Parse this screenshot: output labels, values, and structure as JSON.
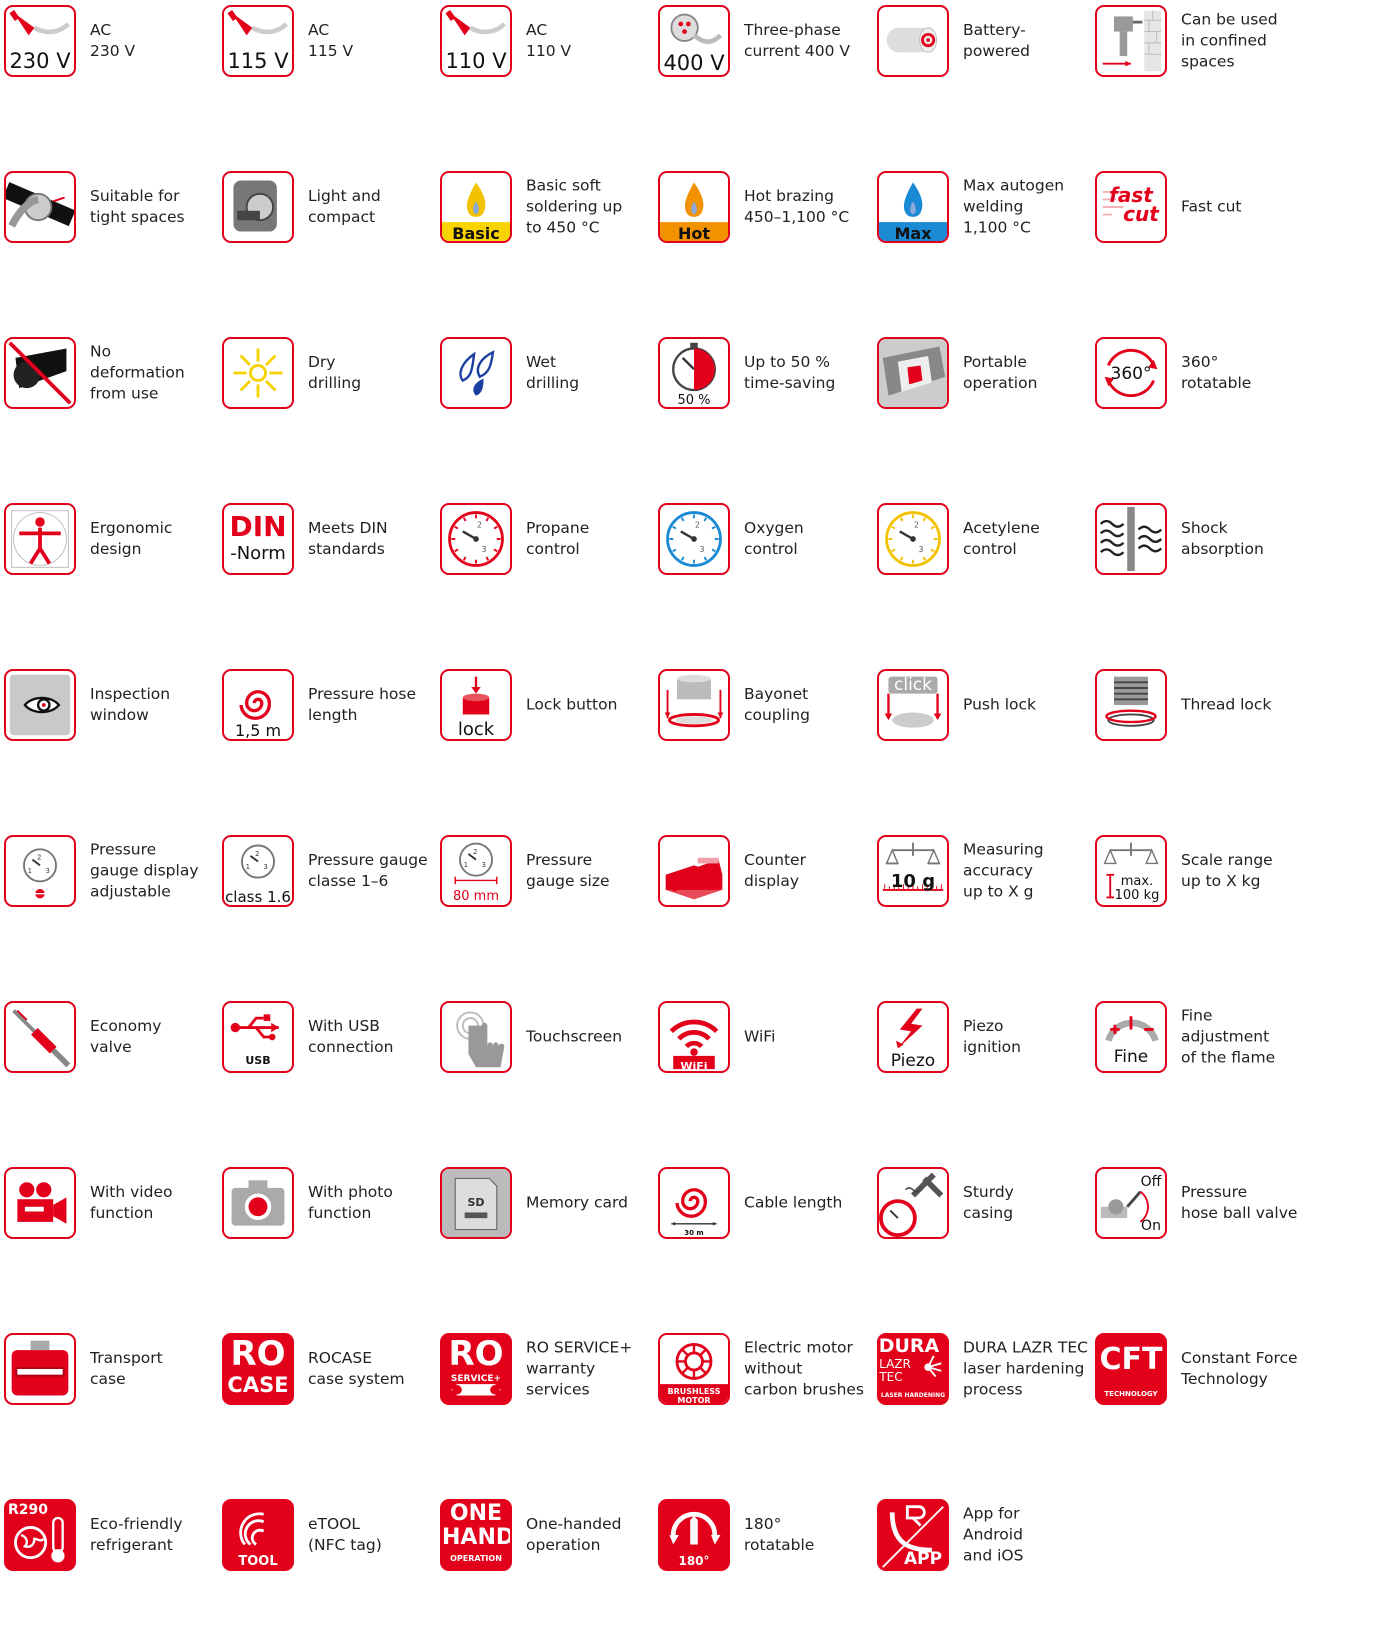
{
  "colors": {
    "brand_red": "#e2001a",
    "text": "#222222",
    "grey": "#9a9a9a",
    "blue": "#1a3fa0",
    "cyan": "#1a8ad4",
    "yellow": "#f2c200",
    "orange": "#f39200"
  },
  "rows": [
    [
      {
        "label": "AC\n230 V",
        "badge": "230 V",
        "icon": "plug-icon"
      },
      {
        "label": "AC\n115 V",
        "badge": "115 V",
        "icon": "plug-icon"
      },
      {
        "label": "AC\n110 V",
        "badge": "110 V",
        "icon": "plug-icon"
      },
      {
        "label": "Three-phase\ncurrent 400 V",
        "badge": "400 V",
        "icon": "three-phase-plug-icon"
      },
      {
        "label": "Battery-\npowered",
        "icon": "battery-icon"
      },
      {
        "label": "Can be used\nin confined\nspaces",
        "icon": "confined-space-icon"
      }
    ],
    [
      {
        "label": "Suitable for\ntight spaces",
        "icon": "tight-space-icon"
      },
      {
        "label": "Light and\ncompact",
        "icon": "compact-tool-icon"
      },
      {
        "label": "Basic soft\nsoldering up\nto 450 °C",
        "badge": "Basic",
        "icon": "flame-basic-icon"
      },
      {
        "label": "Hot brazing\n450–1,100 °C",
        "badge": "Hot",
        "icon": "flame-hot-icon"
      },
      {
        "label": "Max autogen\nwelding\n1,100 °C",
        "badge": "Max",
        "icon": "flame-max-icon"
      },
      {
        "label": "Fast cut",
        "badge": "fast",
        "badge2": "cut",
        "icon": "fast-cut-icon"
      }
    ],
    [
      {
        "label": "No\ndeformation\nfrom use",
        "icon": "no-deformation-icon"
      },
      {
        "label": "Dry\ndrilling",
        "icon": "sun-icon"
      },
      {
        "label": "Wet\ndrilling",
        "icon": "water-drops-icon"
      },
      {
        "label": "Up to 50 %\ntime-saving",
        "badge": "50 %",
        "icon": "stopwatch-icon"
      },
      {
        "label": "Portable\noperation",
        "icon": "portable-icon"
      },
      {
        "label": "360°\nrotatable",
        "badge": "360°",
        "icon": "rotate-360-icon"
      }
    ],
    [
      {
        "label": "Ergonomic\ndesign",
        "icon": "ergonomic-icon"
      },
      {
        "label": "Meets DIN\nstandards",
        "badge": "DIN",
        "badge2": "-Norm",
        "icon": "din-icon"
      },
      {
        "label": "Propane\ncontrol",
        "icon": "gauge-red-icon"
      },
      {
        "label": "Oxygen\ncontrol",
        "icon": "gauge-blue-icon"
      },
      {
        "label": "Acetylene\ncontrol",
        "icon": "gauge-yellow-icon"
      },
      {
        "label": "Shock\nabsorption",
        "icon": "shock-absorption-icon"
      }
    ],
    [
      {
        "label": "Inspection\nwindow",
        "icon": "eye-icon"
      },
      {
        "label": "Pressure hose\nlength",
        "badge": "1,5 m",
        "icon": "hose-spiral-icon"
      },
      {
        "label": "Lock button",
        "badge": "lock",
        "icon": "lock-button-icon"
      },
      {
        "label": "Bayonet\ncoupling",
        "icon": "bayonet-icon"
      },
      {
        "label": "Push lock",
        "badge": "click",
        "icon": "push-lock-icon"
      },
      {
        "label": "Thread lock",
        "icon": "thread-lock-icon"
      }
    ],
    [
      {
        "label": "Pressure\ngauge display\nadjustable",
        "icon": "gauge-adjust-icon"
      },
      {
        "label": "Pressure gauge\nclasse 1–6",
        "badge": "class 1.6",
        "icon": "gauge-class-icon"
      },
      {
        "label": "Pressure\ngauge size",
        "badge": "80 mm",
        "icon": "gauge-size-icon"
      },
      {
        "label": "Counter\ndisplay",
        "icon": "counter-display-icon"
      },
      {
        "label": "Measuring\naccuracy\nup to X g",
        "badge": "10 g",
        "icon": "scale-accuracy-icon"
      },
      {
        "label": "Scale range\nup to X kg",
        "badge": "max.",
        "badge2": "100 kg",
        "icon": "scale-range-icon"
      }
    ],
    [
      {
        "label": "Economy\nvalve",
        "icon": "economy-valve-icon"
      },
      {
        "label": "With USB\nconnection",
        "badge": "USB",
        "icon": "usb-icon"
      },
      {
        "label": "Touchscreen",
        "icon": "touch-icon"
      },
      {
        "label": "WiFi",
        "badge": "WiFi",
        "icon": "wifi-icon"
      },
      {
        "label": "Piezo\nignition",
        "badge": "Piezo",
        "icon": "piezo-icon"
      },
      {
        "label": "Fine\nadjustment\nof the flame",
        "badge": "Fine",
        "icon": "fine-adjust-icon"
      }
    ],
    [
      {
        "label": "With video\nfunction",
        "icon": "video-camera-icon"
      },
      {
        "label": "With photo\nfunction",
        "icon": "photo-camera-icon"
      },
      {
        "label": "Memory card",
        "badge": "SD",
        "icon": "sd-card-icon"
      },
      {
        "label": "Cable length",
        "badge": "30 m",
        "icon": "cable-spiral-icon"
      },
      {
        "label": "Sturdy\ncasing",
        "icon": "hammer-gauge-icon"
      },
      {
        "label": "Pressure\nhose ball valve",
        "badge": "Off",
        "badge2": "On",
        "icon": "ball-valve-icon"
      }
    ],
    [
      {
        "label": "Transport\ncase",
        "icon": "transport-case-icon"
      },
      {
        "label": "ROCASE\ncase system",
        "badge": "RO",
        "badge2": "CASE",
        "icon": "rocase-icon"
      },
      {
        "label": "RO SERVICE+\nwarranty\nservices",
        "badge": "RO",
        "badge2": "SERVICE+",
        "icon": "ro-service-icon"
      },
      {
        "label": "Electric motor\nwithout\ncarbon brushes",
        "badge": "BRUSHLESS",
        "badge2": "MOTOR",
        "icon": "brushless-motor-icon"
      },
      {
        "label": "DURA LAZR TEC\nlaser hardening\nprocess",
        "badge": "DURA",
        "badge2": "LAZR",
        "badge3": "TEC",
        "badge4": "LASER HARDENING",
        "icon": "dura-lazr-icon"
      },
      {
        "label": "Constant Force\nTechnology",
        "badge": "CFT",
        "badge2": "TECHNOLOGY",
        "icon": "cft-icon"
      }
    ],
    [
      {
        "label": "Eco-friendly\nrefrigerant",
        "badge": "R290",
        "icon": "eco-refrigerant-icon"
      },
      {
        "label": "eTOOL\n(NFC tag)",
        "badge": "TOOL",
        "icon": "etool-icon"
      },
      {
        "label": "One-handed\noperation",
        "badge": "ONE",
        "badge2": "HAND",
        "badge3": "OPERATION",
        "icon": "one-hand-icon"
      },
      {
        "label": "180°\nrotatable",
        "badge": "180°",
        "icon": "rotate-180-icon"
      },
      {
        "label": "App for\nAndroid\nand iOS",
        "badge": "APP",
        "icon": "app-icon"
      }
    ]
  ]
}
